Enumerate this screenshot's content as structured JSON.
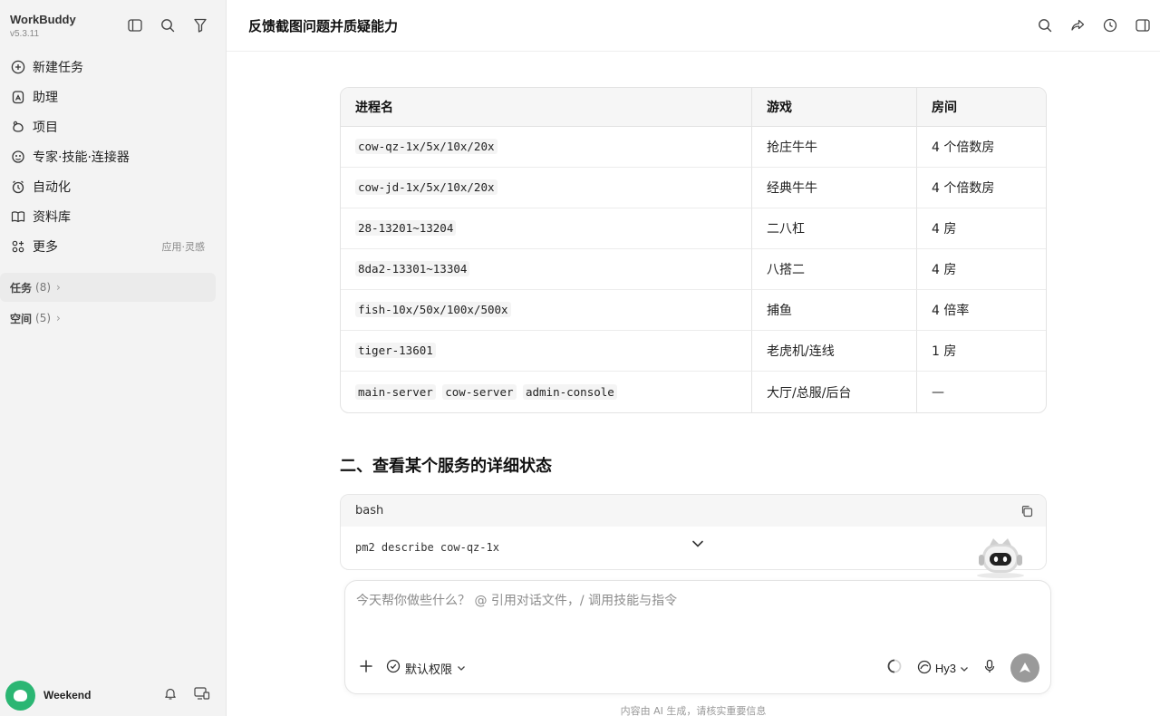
{
  "sidebar": {
    "app_name": "WorkBuddy",
    "version": "v5.3.11",
    "nav": [
      {
        "label": "新建任务",
        "icon": "plus-circle-icon"
      },
      {
        "label": "助理",
        "icon": "assistant-icon"
      },
      {
        "label": "项目",
        "icon": "project-icon"
      },
      {
        "label": "专家·技能·连接器",
        "icon": "expert-icon"
      },
      {
        "label": "自动化",
        "icon": "alarm-clock-icon"
      },
      {
        "label": "资料库",
        "icon": "book-icon"
      },
      {
        "label": "更多",
        "icon": "apps-icon",
        "extra": "应用·灵感"
      }
    ],
    "tasks": {
      "label": "任务",
      "count": "(8)"
    },
    "spaces": {
      "label": "空间",
      "count": "(5)"
    },
    "user": {
      "name": "Weekend"
    }
  },
  "header": {
    "title": "反馈截图问题并质疑能力"
  },
  "table": {
    "headers": [
      "进程名",
      "游戏",
      "房间"
    ],
    "rows": [
      {
        "procs": [
          "cow-qz-1x/5x/10x/20x"
        ],
        "game": "抢庄牛牛",
        "room": "4 个倍数房"
      },
      {
        "procs": [
          "cow-jd-1x/5x/10x/20x"
        ],
        "game": "经典牛牛",
        "room": "4 个倍数房"
      },
      {
        "procs": [
          "28-13201~13204"
        ],
        "game": "二八杠",
        "room": "4 房"
      },
      {
        "procs": [
          "8da2-13301~13304"
        ],
        "game": "八搭二",
        "room": "4 房"
      },
      {
        "procs": [
          "fish-10x/50x/100x/500x"
        ],
        "game": "捕鱼",
        "room": "4 倍率"
      },
      {
        "procs": [
          "tiger-13601"
        ],
        "game": "老虎机/连线",
        "room": "1 房"
      },
      {
        "procs": [
          "main-server",
          "cow-server",
          "admin-console"
        ],
        "game": "大厅/总服/后台",
        "room": "—"
      }
    ]
  },
  "section2": {
    "heading": "二、查看某个服务的详细状态"
  },
  "codeblock": {
    "lang": "bash",
    "code": "pm2 describe cow-qz-1x"
  },
  "composer": {
    "placeholder": "今天帮你做些什么？ @ 引用对话文件，/ 调用技能与指令",
    "permission": "默认权限",
    "model": "Hy3"
  },
  "footer": {
    "note": "内容由 AI 生成，请核实重要信息"
  }
}
